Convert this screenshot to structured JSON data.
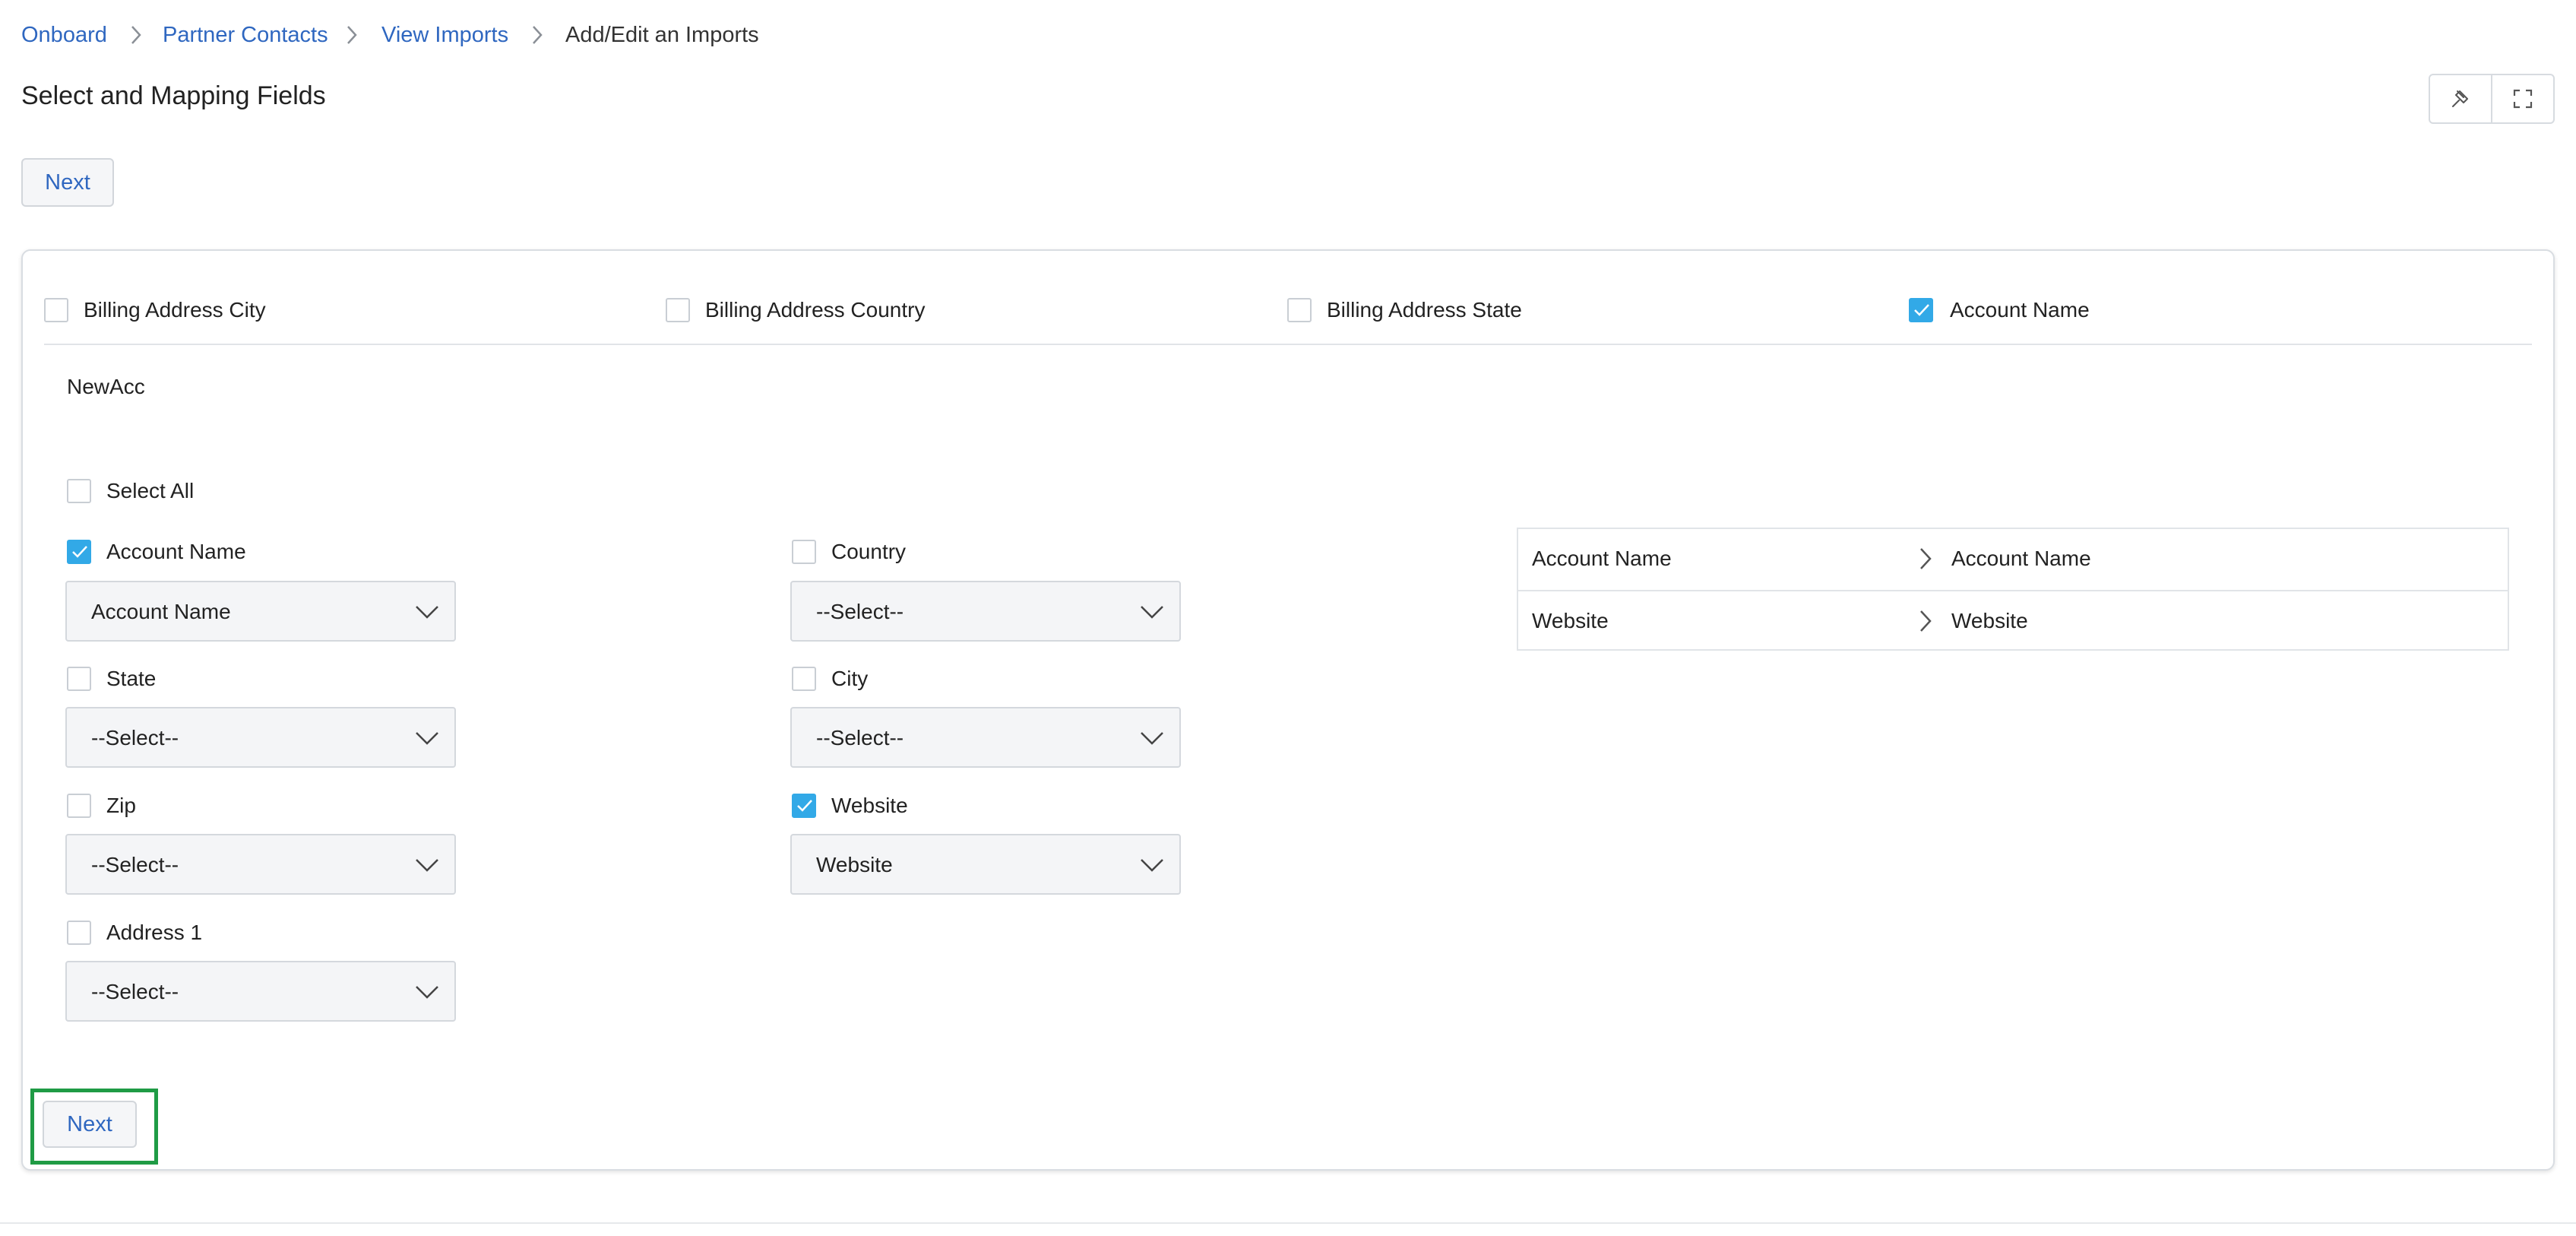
{
  "breadcrumb": {
    "items": [
      "Onboard",
      "Partner Contacts",
      "View Imports"
    ],
    "current": "Add/Edit an Imports"
  },
  "page": {
    "title": "Select and Mapping Fields"
  },
  "toolbar": {
    "pin_icon": "pin-icon",
    "expand_icon": "expand-icon"
  },
  "buttons": {
    "next_top": "Next",
    "next_bottom": "Next"
  },
  "filters": [
    {
      "label": "Billing Address City",
      "checked": false
    },
    {
      "label": "Billing Address Country",
      "checked": false
    },
    {
      "label": "Billing Address State",
      "checked": false
    },
    {
      "label": "Account Name",
      "checked": true
    }
  ],
  "record": {
    "name": "NewAcc"
  },
  "select_all": {
    "label": "Select All",
    "checked": false
  },
  "fields_left": [
    {
      "label": "Account Name",
      "checked": true,
      "value": "Account Name"
    },
    {
      "label": "State",
      "checked": false,
      "value": "--Select--"
    },
    {
      "label": "Zip",
      "checked": false,
      "value": "--Select--"
    },
    {
      "label": "Address 1",
      "checked": false,
      "value": "--Select--"
    }
  ],
  "fields_right": [
    {
      "label": "Country",
      "checked": false,
      "value": "--Select--"
    },
    {
      "label": "City",
      "checked": false,
      "value": "--Select--"
    },
    {
      "label": "Website",
      "checked": true,
      "value": "Website"
    }
  ],
  "mapping": [
    {
      "source": "Account Name",
      "target": "Account Name"
    },
    {
      "source": "Website",
      "target": "Website"
    }
  ],
  "colors": {
    "link": "#2f67c0",
    "checkbox_checked": "#32a9e7",
    "highlight": "#1f9b45"
  }
}
